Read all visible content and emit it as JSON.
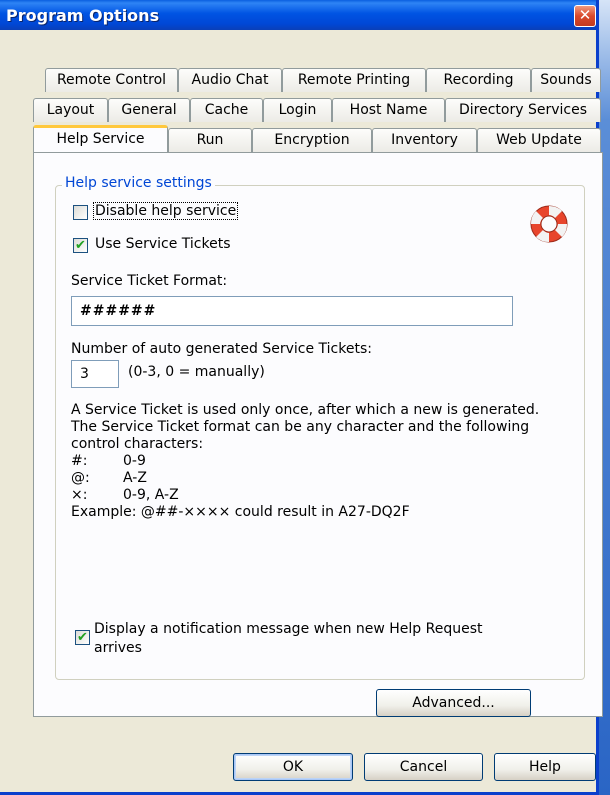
{
  "window": {
    "title": "Program Options",
    "close_icon": "close-icon"
  },
  "tabs": {
    "row1": [
      "Remote Control",
      "Audio Chat",
      "Remote Printing",
      "Recording",
      "Sounds"
    ],
    "row2": [
      "Layout",
      "General",
      "Cache",
      "Login",
      "Host Name",
      "Directory Services"
    ],
    "row3": [
      "Help Service",
      "Run",
      "Encryption",
      "Inventory",
      "Web Update"
    ],
    "active": "Help Service"
  },
  "help_settings": {
    "group_title": "Help service settings",
    "disable_help_label": "Disable help service",
    "disable_help_checked": false,
    "use_tickets_label": "Use Service Tickets",
    "use_tickets_checked": true,
    "icon": "lifebuoy-icon",
    "ticket_format_label": "Service Ticket Format:",
    "ticket_format_value": "######",
    "auto_generated_label": "Number of auto generated Service Tickets:",
    "auto_generated_value": "3",
    "auto_generated_hint": "(0-3, 0 = manually)",
    "description_lines": [
      "A Service Ticket is used only once, after which a new is generated.",
      "The Service Ticket format can be any character and the following",
      "control characters:"
    ],
    "codes": [
      {
        "char": "#:",
        "meaning": "0-9"
      },
      {
        "char": "@:",
        "meaning": "A-Z"
      },
      {
        "char": "×:",
        "meaning": "0-9, A-Z"
      }
    ],
    "example": "Example: @##-×××× could result in A27-DQ2F",
    "notify_label_line1": "Display a notification message when new Help Request",
    "notify_label_line2": "arrives",
    "notify_checked": true,
    "advanced_button": "Advanced..."
  },
  "footer": {
    "ok_button": "OK",
    "cancel_button": "Cancel",
    "help_button": "Help"
  }
}
